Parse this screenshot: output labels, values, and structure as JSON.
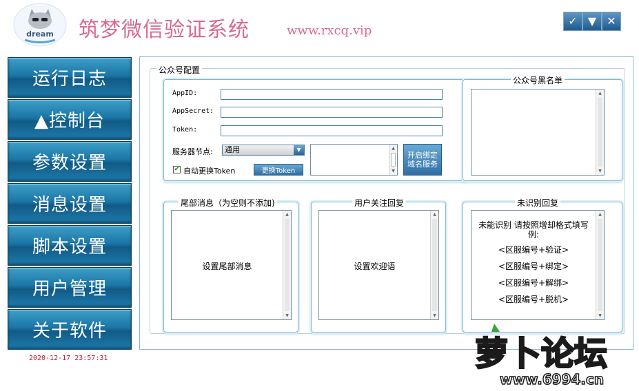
{
  "header": {
    "title": "筑梦微信验证系统",
    "url": "www.rxcq.vip",
    "logo_text": "dream",
    "controls": {
      "confirm": "✓",
      "minimize": "▼",
      "close": "✕"
    }
  },
  "sidebar": {
    "items": [
      {
        "label": "运行日志"
      },
      {
        "label": "▲控制台"
      },
      {
        "label": "参数设置"
      },
      {
        "label": "消息设置"
      },
      {
        "label": "脚本设置"
      },
      {
        "label": "用户管理"
      },
      {
        "label": "关于软件"
      }
    ],
    "timestamp": "2020-12-17 23:57:31"
  },
  "config": {
    "group_title": "公众号配置",
    "appid_label": "AppID:",
    "appid_value": "",
    "appsecret_label": "AppSecret:",
    "appsecret_value": "",
    "token_label": "Token:",
    "token_value": "",
    "server_label": "服务器节点:",
    "server_value": "通用",
    "auto_token_label": "自动更换Token",
    "auto_token_checked": true,
    "change_token_button": "更换Token",
    "bind_domain_button_line1": "开启绑定",
    "bind_domain_button_line2": "域名服务"
  },
  "blacklist": {
    "title": "公众号黑名单"
  },
  "footer_msg": {
    "title": "尾部消息（为空则不添加)",
    "content": "设置尾部消息"
  },
  "follow_reply": {
    "title": "用户关注回复",
    "content": "设置欢迎语"
  },
  "unknown_reply": {
    "title": "未识别回复",
    "line1": "未能识别 请按照增却格式填写",
    "line2": "例:",
    "line3": "<区服编号+验证>",
    "line4": "<区服编号+绑定>",
    "line5": "<区服编号+解绑>",
    "line6": "<区服编号+脱机>"
  },
  "watermark": {
    "text": "萝卜论坛",
    "url": "www.6994.cn"
  },
  "colors": {
    "title_pink": "#d86b8f",
    "nav_blue": "#1a76a6",
    "timestamp_red": "#c0203a",
    "watermark_orange": "#f07d17"
  }
}
